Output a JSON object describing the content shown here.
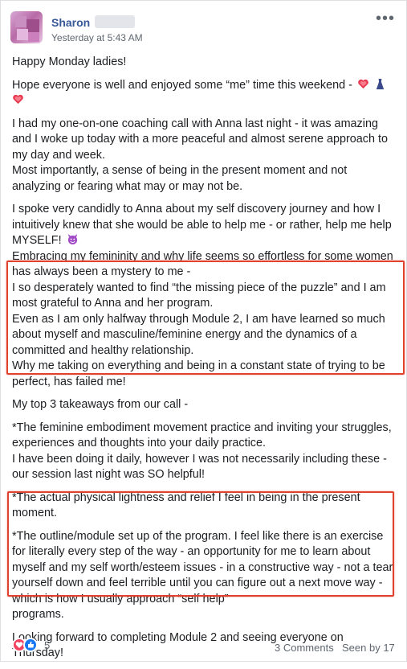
{
  "post": {
    "author": "Sharon",
    "timestamp": "Yesterday at 5:43 AM",
    "more_label": "•••"
  },
  "body": {
    "p1": "Happy Monday ladies!",
    "p2": "Hope everyone is well and enjoyed some “me” time this weekend -",
    "p3": "I had my one-on-one coaching call with Anna last night - it was amazing and I woke up today with a more peaceful and almost serene approach to my day and week.",
    "p3b": "Most importantly, a sense of being in the present moment and not analyzing or fearing what may or may not be.",
    "p4": "I spoke very candidly to Anna about my self discovery journey and how I intuitively knew that she would be able to help me - or rather, help me help MYSELF!",
    "p4b": "Embracing my femininity and why life seems so effortless for some women has always been a mystery to me -",
    "p4c": "I so desperately wanted to find “the missing piece of the puzzle” and I am most grateful to Anna and her program.",
    "p4d": "Even as I am only halfway through Module 2, I am have learned so much about myself and masculine/feminine energy and the dynamics of a committed and healthy relationship.",
    "p4e": "Why me taking on everything and being in a constant state of trying to be perfect, has failed me!",
    "p5": "My top 3 takeaways from our call -",
    "p6": "*The feminine embodiment movement practice and inviting your struggles, experiences and thoughts into your daily practice.",
    "p6b": "I have been doing it daily, however I was not necessarily including these - our session last night was SO helpful!",
    "p7": "*The actual physical lightness and relief I feel in being in the present moment.",
    "p8": "*The outline/module set up of the program. I feel like there is an exercise for literally every step of the way - an opportunity for me to learn about myself and my self worth/esteem issues - in a constructive way - not a tear yourself down and feel terrible until you can figure out a next move way - which is how I usually approach “self help”",
    "p8b": "programs.",
    "p9": "Looking forward to completing Module 2 and seeing everyone on Thursday!"
  },
  "footer": {
    "reaction_count": "5",
    "comments": "3 Comments",
    "seen": "Seen by 17"
  },
  "icons": [
    "heart-emoji-icon",
    "dress-emoji-icon",
    "devil-emoji-icon",
    "love-reaction-icon",
    "like-reaction-icon",
    "more-options-icon"
  ],
  "colors": {
    "author": "#385898",
    "highlight": "#e0422d",
    "love": "#f3425f",
    "like": "#1877f2"
  }
}
